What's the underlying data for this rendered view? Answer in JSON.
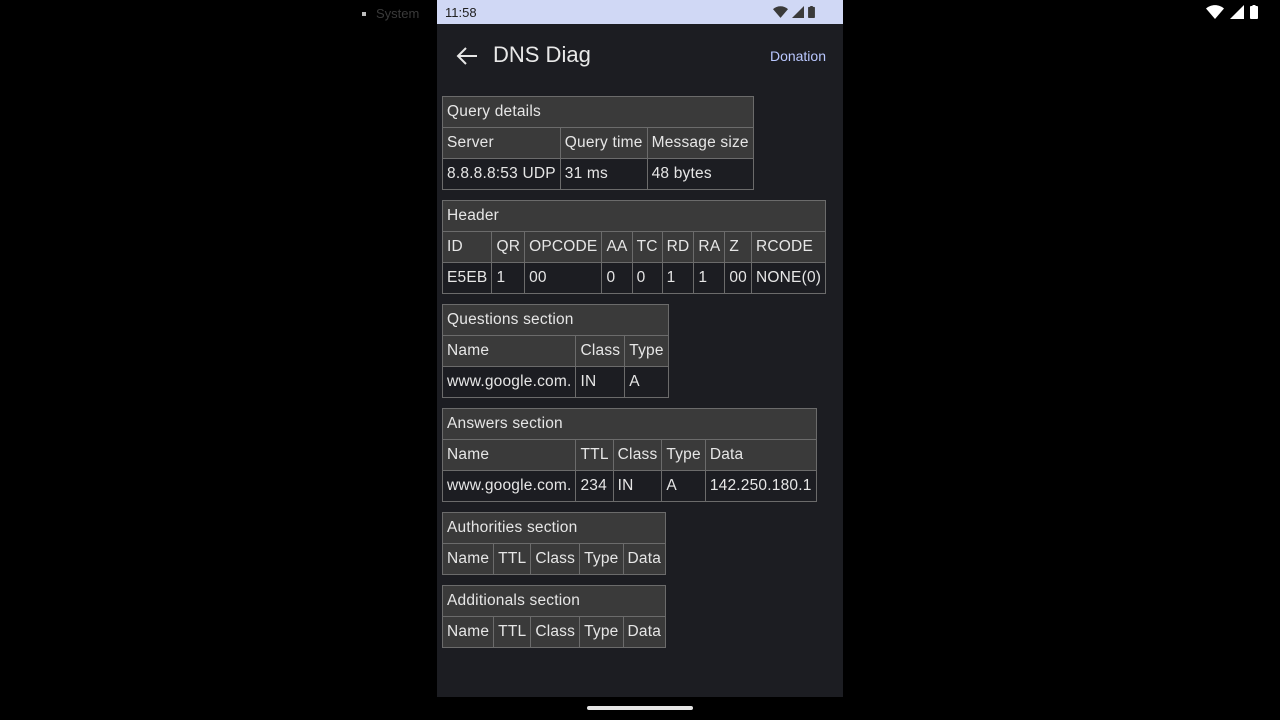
{
  "system": {
    "label": "System"
  },
  "statusbar": {
    "time": "11:58"
  },
  "appbar": {
    "title": "DNS Diag",
    "action": "Donation"
  },
  "query_details": {
    "title": "Query details",
    "headers": [
      "Server",
      "Query time",
      "Message size"
    ],
    "values": [
      "8.8.8.8:53 UDP",
      "31 ms",
      "48 bytes"
    ]
  },
  "header": {
    "title": "Header",
    "headers": [
      "ID",
      "QR",
      "OPCODE",
      "AA",
      "TC",
      "RD",
      "RA",
      "Z",
      "RCODE"
    ],
    "values": [
      "E5EB",
      "1",
      "00",
      "0",
      "0",
      "1",
      "1",
      "00",
      "NONE(0)"
    ]
  },
  "questions": {
    "title": "Questions section",
    "headers": [
      "Name",
      "Class",
      "Type"
    ],
    "values": [
      "www.google.com.",
      "IN",
      "A"
    ]
  },
  "answers": {
    "title": "Answers section",
    "headers": [
      "Name",
      "TTL",
      "Class",
      "Type",
      "Data"
    ],
    "values": [
      "www.google.com.",
      "234",
      "IN",
      "A",
      "142.250.180.1"
    ]
  },
  "authorities": {
    "title": "Authorities section",
    "headers": [
      "Name",
      "TTL",
      "Class",
      "Type",
      "Data"
    ]
  },
  "additionals": {
    "title": "Additionals section",
    "headers": [
      "Name",
      "TTL",
      "Class",
      "Type",
      "Data"
    ]
  }
}
